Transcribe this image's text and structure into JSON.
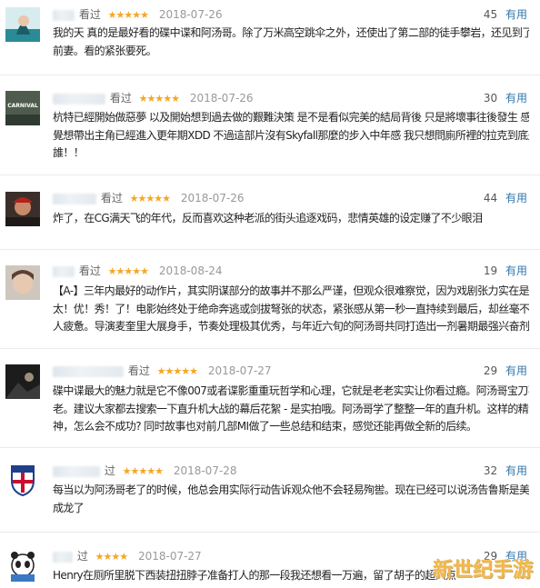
{
  "reviews": [
    {
      "watched": "看过",
      "stars": "★★★★★",
      "date": "2018-07-26",
      "count": "45",
      "useful": "有用",
      "lines": [
        "我的天 真的是最好看的碟中谍和阿汤哥。除了万米高空跳伞之外，还使出了第二部的徒手攀岩，还见到了",
        "前妻。看的紧张要死。"
      ]
    },
    {
      "watched": "看过",
      "stars": "★★★★★",
      "date": "2018-07-26",
      "count": "30",
      "useful": "有用",
      "avatar_text": "CARNIVAL",
      "lines": [
        "杭特已經開始做惡夢 以及開始想到過去做的艱難決策 是不是看似完美的結局背後 只是將壞事往後發生 感",
        "覺想帶出主角已經進入更年期XDD 不過這部片沒有Skyfall那麼的步入中年感 我只想問廁所裡的拉克到底是",
        "誰！！"
      ]
    },
    {
      "watched": "看过",
      "stars": "★★★★★",
      "date": "2018-07-26",
      "count": "44",
      "useful": "有用",
      "lines": [
        "炸了，在CG满天飞的年代，反而喜欢这种老派的街头追逐戏码，悲情英雄的设定赚了不少眼泪"
      ]
    },
    {
      "watched": "看过",
      "stars": "★★★★★",
      "date": "2018-08-24",
      "count": "19",
      "useful": "有用",
      "lines": [
        "【A-】三年内最好的动作片，其实阴谋部分的故事并不那么严谨，但观众很难察觉，因为戏剧张力实在是",
        "太！优！秀！了！电影始终处于绝命奔逃或剑拔弩张的状态，紧张感从第一秒一直持续到最后，却丝毫不让",
        "人疲惫。导演麦奎里大展身手，节奏处理极其优秀，与年近六旬的阿汤哥共同打造出一剂暑期最强兴奋剂"
      ]
    },
    {
      "watched": "看过",
      "stars": "★★★★★",
      "date": "2018-07-27",
      "count": "29",
      "useful": "有用",
      "lines": [
        "碟中谍最大的魅力就是它不像007或者谍影重重玩哲学和心理，它就是老老实实让你看过瘾。阿汤哥宝刀不",
        "老。建议大家都去搜索一下直升机大战的幕后花絮 - 是实拍哦。阿汤哥学了整整一年的直升机。这样的精",
        "神，怎么会不成功? 同时故事也对前几部MI做了一些总结和结束，感觉还能再做全新的后续。"
      ]
    },
    {
      "watched": "过",
      "stars": "★★★★★",
      "date": "2018-07-28",
      "count": "32",
      "useful": "有用",
      "lines": [
        "每当以为阿汤哥老了的时候，他总会用实际行动告诉观众他不会轻易殉喾。现在已经可以说汤告鲁斯是美国",
        "成龙了"
      ]
    },
    {
      "watched": "过",
      "stars": "★★★★",
      "date": "2018-07-27",
      "count": "29",
      "useful": "有用",
      "lines": [
        "Henry在厕所里脱下西装扭扭脖子准备打人的那一段我还想看一万遍，留了胡子的超人点"
      ]
    }
  ],
  "watermark": "新世纪手游"
}
